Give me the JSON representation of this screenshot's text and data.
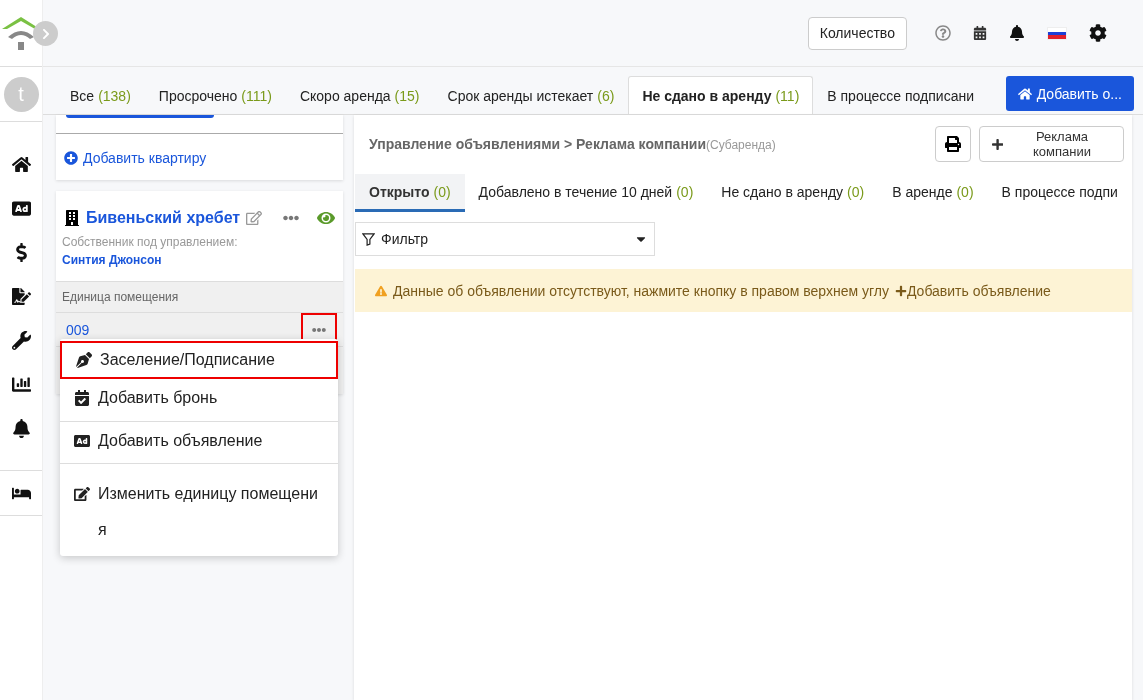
{
  "sidebar": {
    "avatar": "t",
    "items": [
      {
        "kind": "home",
        "selected": false
      },
      {
        "kind": "ad",
        "selected": false
      },
      {
        "kind": "dollar",
        "selected": false
      },
      {
        "kind": "signature",
        "selected": false
      },
      {
        "kind": "wrench",
        "selected": false
      },
      {
        "kind": "chart",
        "selected": false
      },
      {
        "kind": "bell",
        "selected": false
      },
      {
        "kind": "bed",
        "selected": false
      }
    ]
  },
  "header": {
    "count_button": "Количество"
  },
  "tabs": [
    {
      "label": "Все",
      "count": "(138)",
      "selected": false
    },
    {
      "label": "Просрочено",
      "count": "(111)",
      "selected": false
    },
    {
      "label": "Скоро аренда",
      "count": "(15)",
      "selected": false
    },
    {
      "label": "Срок аренды истекает",
      "count": "(6)",
      "selected": false
    },
    {
      "label": "Не сдано в аренду",
      "count": "(11)",
      "selected": true
    },
    {
      "label": "В процессе подписани",
      "selected": false
    }
  ],
  "add_button": "Добавить о...",
  "left": {
    "add_apartment": "Добавить квартиру",
    "property": {
      "name": "Бивеньский хребет",
      "owner_label": "Собственник под управлением:",
      "owner": "Синтия Джонсон",
      "visible": true
    },
    "unit_header": "Единица помещения",
    "unit": "009",
    "menu_button_highlighted": true,
    "menu": [
      {
        "kind": "pen",
        "label": "Заселение/Подписание",
        "highlighted": true
      },
      {
        "kind": "calendar",
        "label": "Добавить бронь",
        "highlighted": false
      },
      {
        "kind": "ad",
        "label": "Добавить объявление",
        "highlighted": false
      },
      {
        "kind": "edit",
        "label": "Изменить единицу помещения",
        "highlighted": false
      }
    ]
  },
  "panel": {
    "breadcrumb": [
      "Управление объявлениями",
      "Реклама компании"
    ],
    "breadcrumb_note": "(Субаренда)",
    "separator": ">",
    "company_button": "Реклама компании",
    "subtabs": [
      {
        "label": "Открыто",
        "count": "(0)",
        "selected": true
      },
      {
        "label": "Добавлено в течение 10 дней",
        "count": "(0)",
        "selected": false
      },
      {
        "label": "Не сдано в аренду",
        "count": "(0)",
        "selected": false
      },
      {
        "label": "В аренде",
        "count": "(0)",
        "selected": false
      },
      {
        "label": "В процессе подпи",
        "selected": false
      }
    ],
    "filter": "Фильтр",
    "alert": "Данные об объявлении отсутствуют, нажмите кнопку в правом верхнем углу",
    "alert_link": "Добавить объявление"
  }
}
